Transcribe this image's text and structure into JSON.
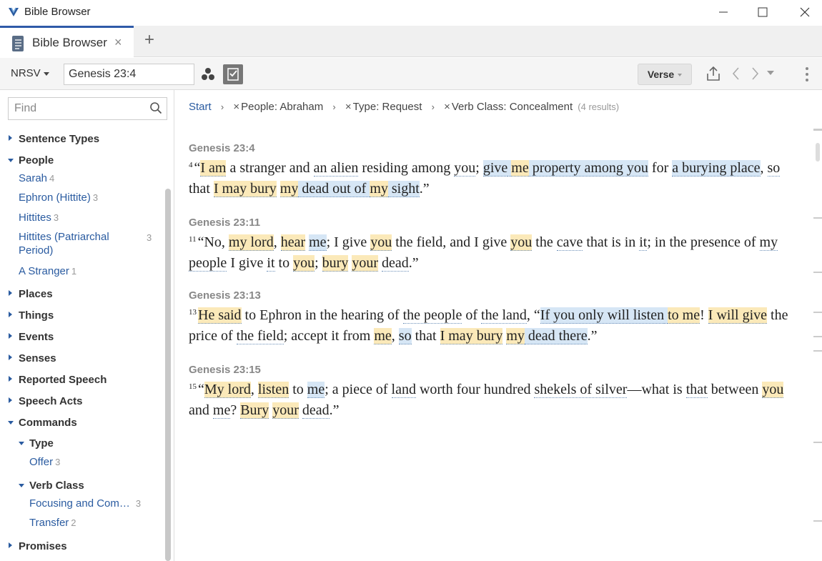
{
  "window": {
    "title": "Bible Browser"
  },
  "tab": {
    "label": "Bible Browser",
    "close": "×",
    "add": "+"
  },
  "toolbar": {
    "version": "NRSV",
    "reference": "Genesis 23:4",
    "layout_button": "Verse"
  },
  "sidebar": {
    "find_placeholder": "Find",
    "items": [
      {
        "label": "Sentence Types",
        "kind": "category",
        "expanded": false
      },
      {
        "label": "People",
        "kind": "category",
        "expanded": true
      },
      {
        "label": "Sarah",
        "kind": "leaf",
        "count": "4"
      },
      {
        "label": "Ephron (Hittite)",
        "kind": "leaf",
        "count": "3"
      },
      {
        "label": "Hittites",
        "kind": "leaf",
        "count": "3"
      },
      {
        "label": "Hittites (Patriarchal",
        "label2": "Period)",
        "kind": "leaf",
        "count": "3"
      },
      {
        "label": "A Stranger",
        "kind": "leaf",
        "count": "1"
      },
      {
        "label": "Places",
        "kind": "category",
        "expanded": false
      },
      {
        "label": "Things",
        "kind": "category",
        "expanded": false
      },
      {
        "label": "Events",
        "kind": "category",
        "expanded": false
      },
      {
        "label": "Senses",
        "kind": "category",
        "expanded": false
      },
      {
        "label": "Reported Speech",
        "kind": "category",
        "expanded": false
      },
      {
        "label": "Speech Acts",
        "kind": "category",
        "expanded": false
      },
      {
        "label": "Commands",
        "kind": "category",
        "expanded": true
      },
      {
        "label": "Type",
        "kind": "subcategory",
        "expanded": true
      },
      {
        "label": "Offer",
        "kind": "leaf",
        "count": "3"
      },
      {
        "label": "Verb Class",
        "kind": "subcategory",
        "expanded": true
      },
      {
        "label": "Focusing and Com…",
        "kind": "leaf",
        "count": "3"
      },
      {
        "label": "Transfer",
        "kind": "leaf",
        "count": "2"
      },
      {
        "label": "Promises",
        "kind": "category",
        "expanded": false
      }
    ]
  },
  "breadcrumb": {
    "start": "Start",
    "filters": [
      "People: Abraham",
      "Type: Request",
      "Verb Class: Concealment"
    ],
    "results": "(4 results)"
  },
  "verses": [
    {
      "ref": "Genesis 23:4",
      "num": "4",
      "segments": [
        {
          "t": "“",
          "s": ""
        },
        {
          "t": "I am",
          "s": "hy"
        },
        {
          "t": " a stranger and ",
          "s": ""
        },
        {
          "t": "an alien",
          "s": "ul"
        },
        {
          "t": " residing among ",
          "s": ""
        },
        {
          "t": "you",
          "s": "ul"
        },
        {
          "t": "; ",
          "s": ""
        },
        {
          "t": "give",
          "s": "hb"
        },
        {
          "t": " ",
          "s": "hb"
        },
        {
          "t": "me",
          "s": "hy"
        },
        {
          "t": " property among you",
          "s": "hb"
        },
        {
          "t": " for ",
          "s": ""
        },
        {
          "t": "a burying place",
          "s": "hb"
        },
        {
          "t": ", ",
          "s": ""
        },
        {
          "t": "so",
          "s": "ul"
        },
        {
          "t": " that ",
          "s": ""
        },
        {
          "t": "I may bury",
          "s": "hy"
        },
        {
          "t": " ",
          "s": ""
        },
        {
          "t": "my",
          "s": "hy"
        },
        {
          "t": " dead out of ",
          "s": "hb"
        },
        {
          "t": "my",
          "s": "hy"
        },
        {
          "t": " sight",
          "s": "hb"
        },
        {
          "t": ".”",
          "s": ""
        }
      ]
    },
    {
      "ref": "Genesis 23:11",
      "num": "11",
      "segments": [
        {
          "t": "“No, ",
          "s": ""
        },
        {
          "t": "my lord",
          "s": "hy"
        },
        {
          "t": ", ",
          "s": ""
        },
        {
          "t": "hear",
          "s": "hy"
        },
        {
          "t": " ",
          "s": ""
        },
        {
          "t": "me",
          "s": "hb"
        },
        {
          "t": "; I give ",
          "s": ""
        },
        {
          "t": "you",
          "s": "hy"
        },
        {
          "t": " the field, and I give ",
          "s": ""
        },
        {
          "t": "you",
          "s": "hy"
        },
        {
          "t": " the ",
          "s": ""
        },
        {
          "t": "cave",
          "s": "ul"
        },
        {
          "t": " that is in ",
          "s": ""
        },
        {
          "t": "it",
          "s": "ul"
        },
        {
          "t": "; in the presence of ",
          "s": ""
        },
        {
          "t": "my people",
          "s": "ul"
        },
        {
          "t": " I give ",
          "s": ""
        },
        {
          "t": "it",
          "s": "ul"
        },
        {
          "t": " to ",
          "s": ""
        },
        {
          "t": "you",
          "s": "hy"
        },
        {
          "t": "; ",
          "s": ""
        },
        {
          "t": "bury",
          "s": "hy"
        },
        {
          "t": " ",
          "s": ""
        },
        {
          "t": "your",
          "s": "hy"
        },
        {
          "t": " ",
          "s": ""
        },
        {
          "t": "dead",
          "s": "ul"
        },
        {
          "t": ".”",
          "s": ""
        }
      ]
    },
    {
      "ref": "Genesis 23:13",
      "num": "13",
      "segments": [
        {
          "t": "He said",
          "s": "hy"
        },
        {
          "t": " to Ephron in the hearing of ",
          "s": ""
        },
        {
          "t": "the people",
          "s": "ul"
        },
        {
          "t": " of ",
          "s": ""
        },
        {
          "t": "the land",
          "s": "ul"
        },
        {
          "t": ", “",
          "s": ""
        },
        {
          "t": "If you only will listen",
          "s": "hb"
        },
        {
          "t": " ",
          "s": "hb"
        },
        {
          "t": "to me",
          "s": "hy"
        },
        {
          "t": "! ",
          "s": ""
        },
        {
          "t": "I will give",
          "s": "hy"
        },
        {
          "t": " the price of ",
          "s": ""
        },
        {
          "t": "the field",
          "s": "ul"
        },
        {
          "t": "; accept it from ",
          "s": ""
        },
        {
          "t": "me",
          "s": "hy"
        },
        {
          "t": ", ",
          "s": ""
        },
        {
          "t": "so",
          "s": "hb"
        },
        {
          "t": " that ",
          "s": ""
        },
        {
          "t": "I may bury",
          "s": "hy"
        },
        {
          "t": " ",
          "s": ""
        },
        {
          "t": "my",
          "s": "hy"
        },
        {
          "t": " dead there",
          "s": "hb"
        },
        {
          "t": ".”",
          "s": ""
        }
      ]
    },
    {
      "ref": "Genesis 23:15",
      "num": "15",
      "segments": [
        {
          "t": "“",
          "s": ""
        },
        {
          "t": "My lord",
          "s": "hy"
        },
        {
          "t": ", ",
          "s": ""
        },
        {
          "t": "listen",
          "s": "hy"
        },
        {
          "t": " to ",
          "s": ""
        },
        {
          "t": "me",
          "s": "hb"
        },
        {
          "t": "; a piece of ",
          "s": ""
        },
        {
          "t": "land",
          "s": "ul"
        },
        {
          "t": " worth four hundred ",
          "s": ""
        },
        {
          "t": "shekels of silver",
          "s": "ul"
        },
        {
          "t": "—what is ",
          "s": ""
        },
        {
          "t": "that",
          "s": "ul"
        },
        {
          "t": " between ",
          "s": ""
        },
        {
          "t": "you",
          "s": "hy"
        },
        {
          "t": " and ",
          "s": ""
        },
        {
          "t": "me",
          "s": "ul"
        },
        {
          "t": "? ",
          "s": ""
        },
        {
          "t": "Bury",
          "s": "hy"
        },
        {
          "t": " ",
          "s": ""
        },
        {
          "t": "your",
          "s": "hy"
        },
        {
          "t": " ",
          "s": ""
        },
        {
          "t": "dead",
          "s": "ul"
        },
        {
          "t": ".”",
          "s": ""
        }
      ]
    }
  ],
  "colors": {
    "accent": "#2a5ba0",
    "highlight_yellow": "#fbe9b9",
    "highlight_blue": "#d6e6f5"
  },
  "icons": [
    "bible-browser-logo-icon",
    "minimize-icon",
    "maximize-icon",
    "close-icon",
    "book-icon",
    "plus-icon",
    "search-icon",
    "visual-filter-icon",
    "check-panel-icon",
    "share-icon",
    "back-arrow-icon",
    "forward-arrow-icon",
    "history-dropdown-icon",
    "more-options-icon"
  ]
}
